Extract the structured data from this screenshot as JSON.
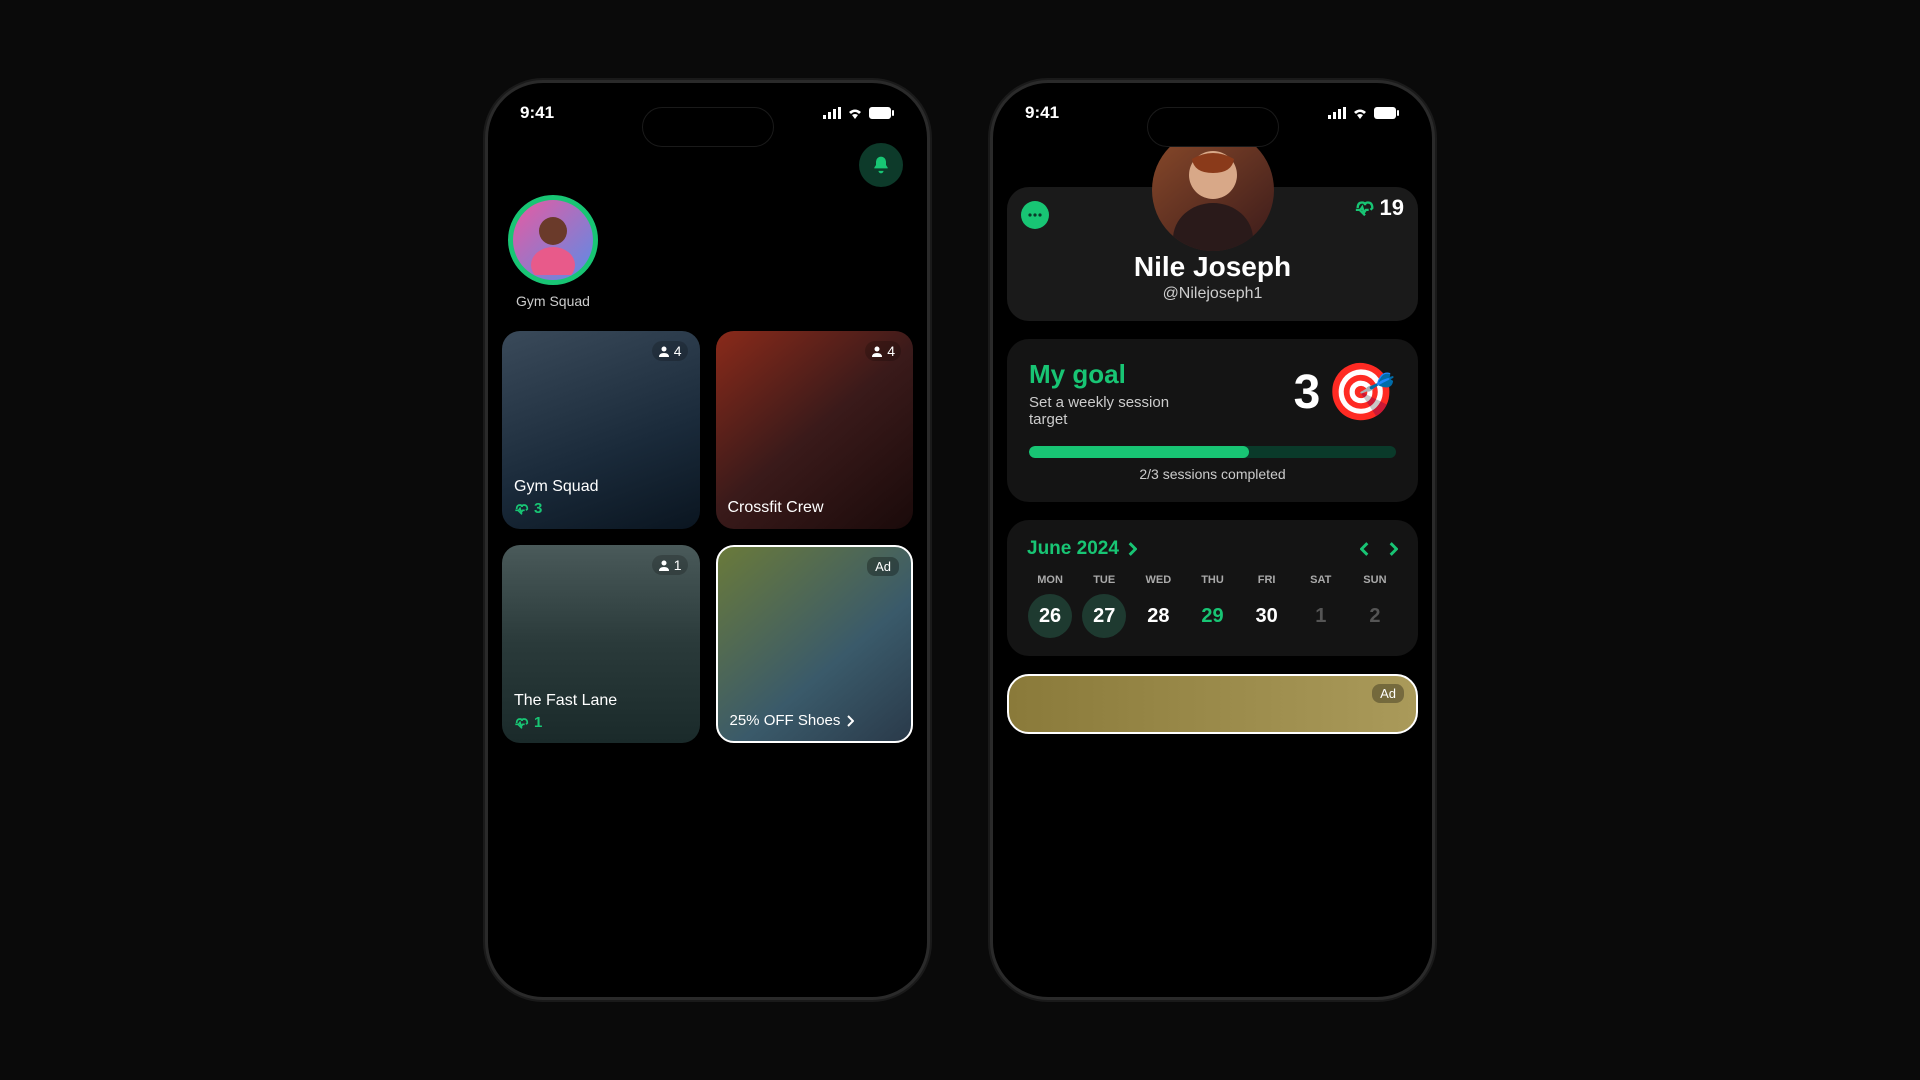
{
  "status": {
    "time": "9:41"
  },
  "colors": {
    "accent": "#18c574"
  },
  "phone1": {
    "story": {
      "label": "Gym Squad"
    },
    "cards": [
      {
        "title": "Gym Squad",
        "members": "4",
        "stat": "3"
      },
      {
        "title": "Crossfit Crew",
        "members": "4"
      },
      {
        "title": "The Fast Lane",
        "members": "1",
        "stat": "1"
      },
      {
        "title": "25% OFF Shoes",
        "badge": "Ad"
      }
    ]
  },
  "phone2": {
    "profile": {
      "name": "Nile Joseph",
      "handle": "@Nilejoseph1",
      "score": "19"
    },
    "goal": {
      "title": "My goal",
      "subtitle": "Set a weekly session target",
      "value": "3",
      "progress_label": "2/3 sessions completed",
      "progress_pct": 60
    },
    "calendar": {
      "month": "June 2024",
      "dow": [
        "MON",
        "TUE",
        "WED",
        "THU",
        "FRI",
        "SAT",
        "SUN"
      ],
      "days": [
        {
          "n": "26",
          "cls": "past"
        },
        {
          "n": "27",
          "cls": "past"
        },
        {
          "n": "28",
          "cls": ""
        },
        {
          "n": "29",
          "cls": "active"
        },
        {
          "n": "30",
          "cls": ""
        },
        {
          "n": "1",
          "cls": "dim"
        },
        {
          "n": "2",
          "cls": "dim"
        }
      ]
    },
    "ad": {
      "badge": "Ad"
    }
  }
}
